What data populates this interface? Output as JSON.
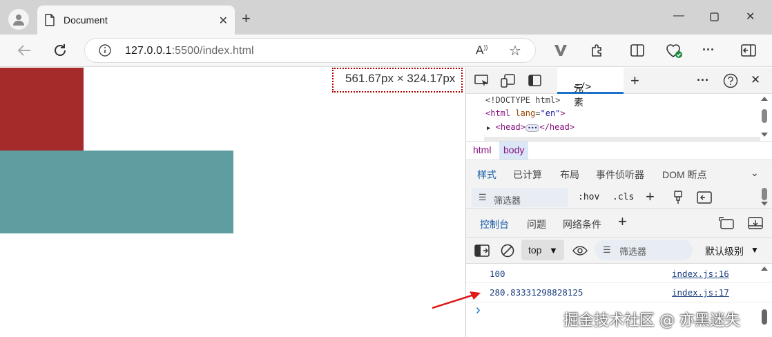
{
  "browser": {
    "tab_title": "Document",
    "url_host": "127.0.0.1",
    "url_rest": ":5500/index.html"
  },
  "page": {
    "dimension_label": "561.67px × 324.17px",
    "colors": {
      "red_box": "#a52a2a",
      "teal_box": "#5f9ea0"
    }
  },
  "devtools": {
    "elements_tab": "元素",
    "code": {
      "doctype": "<!DOCTYPE html>",
      "html_open_tag": "<html",
      "html_attr": "lang",
      "html_attr_value": "\"en\"",
      "html_close": ">",
      "head_open": "<head>",
      "head_dots": "•••",
      "head_close": "</head>"
    },
    "breadcrumbs": [
      "html",
      "body"
    ],
    "subtabs": [
      "样式",
      "已计算",
      "布局",
      "事件侦听器",
      "DOM 断点"
    ],
    "styles_filter_placeholder": "筛选器",
    "hov": ":hov",
    "cls": ".cls",
    "drawer_tabs": [
      "控制台",
      "问题",
      "网络条件"
    ],
    "console_context": "top",
    "console_filter_placeholder": "筛选器",
    "log_level": "默认级别",
    "logs": [
      {
        "value": "100",
        "source": "index.js:16"
      },
      {
        "value": "280.83331298828125",
        "source": "index.js:17"
      }
    ],
    "prompt": "›"
  },
  "watermark": "掘金技术社区 @ 亦黑迷失"
}
